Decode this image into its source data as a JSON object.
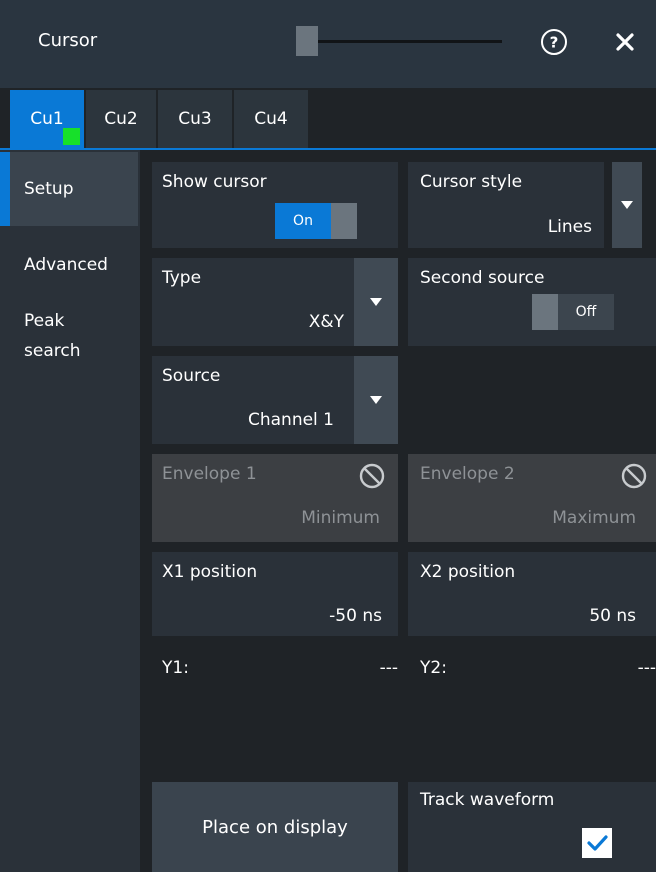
{
  "window": {
    "title": "Cursor"
  },
  "tabs": [
    {
      "label": "Cu1",
      "active": true
    },
    {
      "label": "Cu2",
      "active": false
    },
    {
      "label": "Cu3",
      "active": false
    },
    {
      "label": "Cu4",
      "active": false
    }
  ],
  "sidebar": {
    "items": [
      {
        "label": "Setup",
        "active": true
      },
      {
        "label": "Advanced",
        "active": false
      },
      {
        "label": "Peak search",
        "active": false
      }
    ]
  },
  "setup": {
    "show_cursor": {
      "label": "Show cursor",
      "state": "On"
    },
    "cursor_style": {
      "label": "Cursor style",
      "value": "Lines"
    },
    "type": {
      "label": "Type",
      "value": "X&Y"
    },
    "second_source": {
      "label": "Second source",
      "state": "Off"
    },
    "source": {
      "label": "Source",
      "value": "Channel 1"
    },
    "envelope1": {
      "label": "Envelope 1",
      "value": "Minimum"
    },
    "envelope2": {
      "label": "Envelope 2",
      "value": "Maximum"
    },
    "x1_position": {
      "label": "X1 position",
      "value": "-50",
      "unit": "ns"
    },
    "x2_position": {
      "label": "X2 position",
      "value": "50",
      "unit": "ns"
    },
    "y1": {
      "label": "Y1:",
      "value": "---"
    },
    "y2": {
      "label": "Y2:",
      "value": "---"
    },
    "place_on_display": "Place on display",
    "track_waveform": {
      "label": "Track waveform",
      "checked": true
    }
  },
  "colors": {
    "accent": "#0a79d6",
    "tab_marker": "#17e02a",
    "background": "#1f2327",
    "panel": "#2a3139",
    "disabled_panel": "#3c3f43"
  }
}
